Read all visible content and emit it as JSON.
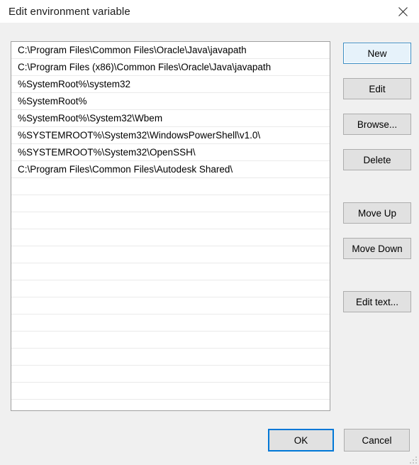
{
  "window": {
    "title": "Edit environment variable",
    "close_icon": "close-icon"
  },
  "colors": {
    "accent": "#0078d7",
    "focus_border": "#3c8ec4",
    "body_background": "#f0f0f0",
    "titlebar_background": "#ffffff",
    "listbox_background": "#ffffff",
    "button_face": "#e1e1e1",
    "button_border": "#adadad",
    "row_separator": "#eaeaea",
    "text": "#000000"
  },
  "list": {
    "entries": [
      "C:\\Program Files\\Common Files\\Oracle\\Java\\javapath",
      "C:\\Program Files (x86)\\Common Files\\Oracle\\Java\\javapath",
      "%SystemRoot%\\system32",
      "%SystemRoot%",
      "%SystemRoot%\\System32\\Wbem",
      "%SYSTEMROOT%\\System32\\WindowsPowerShell\\v1.0\\",
      "%SYSTEMROOT%\\System32\\OpenSSH\\",
      "C:\\Program Files\\Common Files\\Autodesk Shared\\"
    ],
    "empty_row_count": 13
  },
  "side_buttons": [
    {
      "id": "new",
      "label": "New",
      "focused": true
    },
    {
      "id": "edit",
      "label": "Edit",
      "focused": false
    },
    {
      "id": "browse",
      "label": "Browse...",
      "focused": false
    },
    {
      "id": "delete",
      "label": "Delete",
      "focused": false
    },
    {
      "id": "moveup",
      "label": "Move Up",
      "focused": false
    },
    {
      "id": "movedown",
      "label": "Move Down",
      "focused": false
    },
    {
      "id": "edittext",
      "label": "Edit text...",
      "focused": false
    }
  ],
  "bottom_buttons": {
    "ok": "OK",
    "cancel": "Cancel"
  }
}
